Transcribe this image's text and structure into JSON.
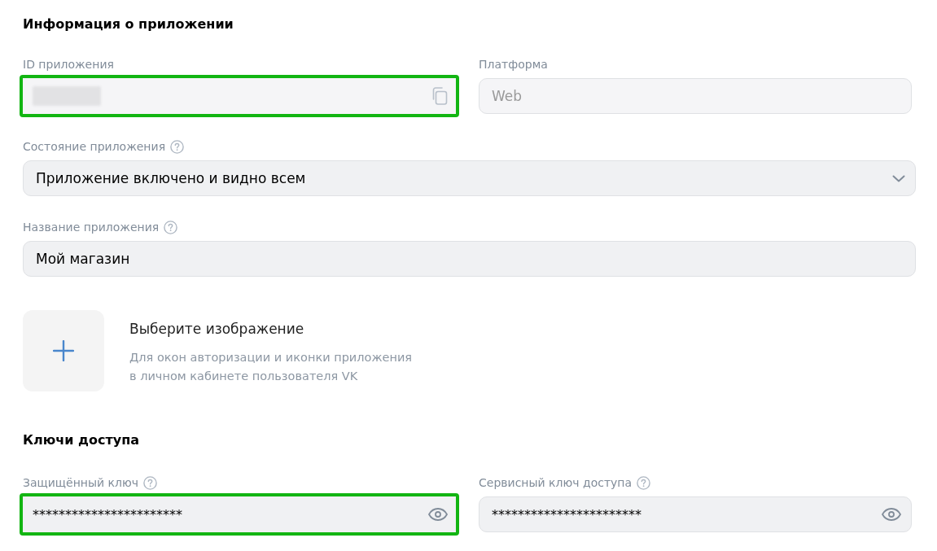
{
  "app_info": {
    "title": "Информация о приложении",
    "id_field": {
      "label": "ID приложения",
      "help": false,
      "redacted": true,
      "highlighted": true
    },
    "platform_field": {
      "label": "Платформа",
      "help": false,
      "value": "Web",
      "disabled": true
    },
    "state_select": {
      "label": "Состояние приложения",
      "help": true,
      "value": "Приложение включено и видно всем"
    },
    "name_field": {
      "label": "Название приложения",
      "help": true,
      "value": "Мой магазин"
    },
    "image_picker": {
      "title": "Выберите изображение",
      "description": [
        "Для окон авторизации и иконки приложения",
        "в личном кабинете пользователя VK"
      ]
    }
  },
  "access_keys": {
    "title": "Ключи доступа",
    "fields": [
      {
        "label": "Защищённый ключ",
        "help": true,
        "value": "***********************",
        "highlighted": true
      },
      {
        "label": "Сервисный ключ доступа",
        "help": true,
        "value": "***********************",
        "highlighted": false
      }
    ]
  }
}
